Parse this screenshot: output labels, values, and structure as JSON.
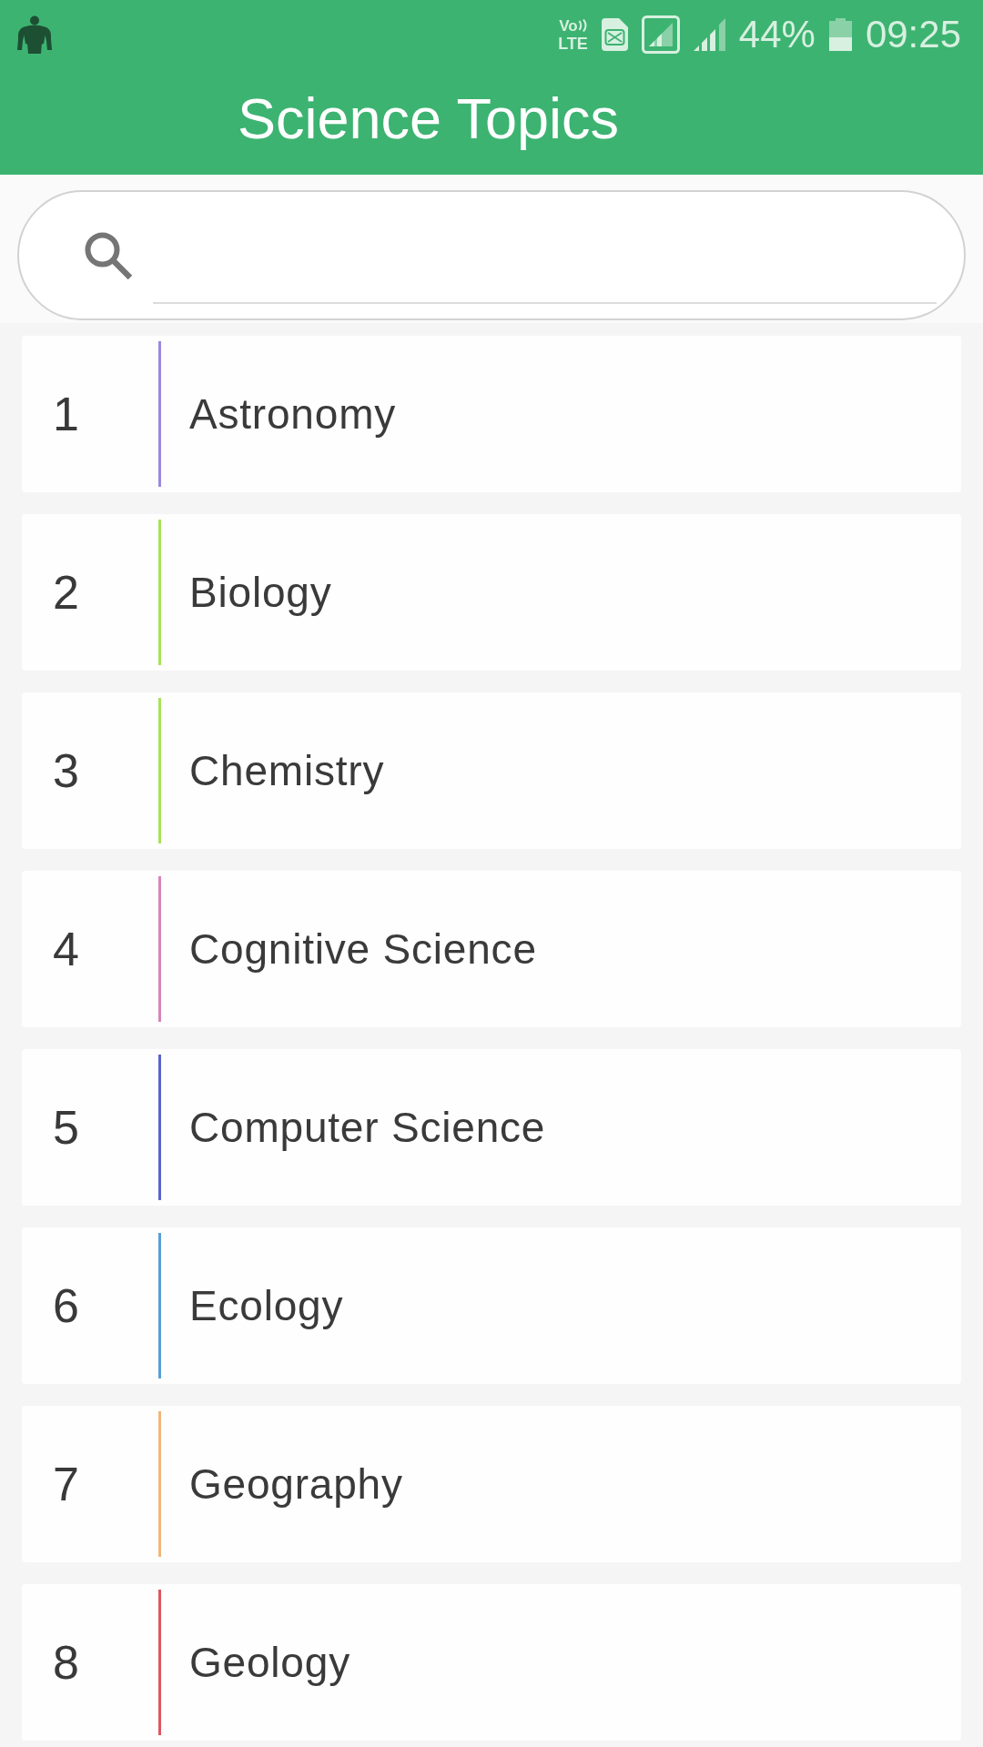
{
  "status_bar": {
    "network": {
      "top": "Vo",
      "bottom": "LTE"
    },
    "battery": "44%",
    "time": "09:25"
  },
  "app_bar": {
    "title": "Science Topics"
  },
  "topics": [
    {
      "number": "1",
      "name": "Astronomy",
      "color": "#9c88e0"
    },
    {
      "number": "2",
      "name": "Biology",
      "color": "#a6e25a"
    },
    {
      "number": "3",
      "name": "Chemistry",
      "color": "#a6e25a"
    },
    {
      "number": "4",
      "name": "Cognitive Science",
      "color": "#d884bb"
    },
    {
      "number": "5",
      "name": "Computer Science",
      "color": "#5a63cc"
    },
    {
      "number": "6",
      "name": "Ecology",
      "color": "#5a9ed8"
    },
    {
      "number": "7",
      "name": "Geography",
      "color": "#f2b57c"
    },
    {
      "number": "8",
      "name": "Geology",
      "color": "#e05660"
    }
  ]
}
